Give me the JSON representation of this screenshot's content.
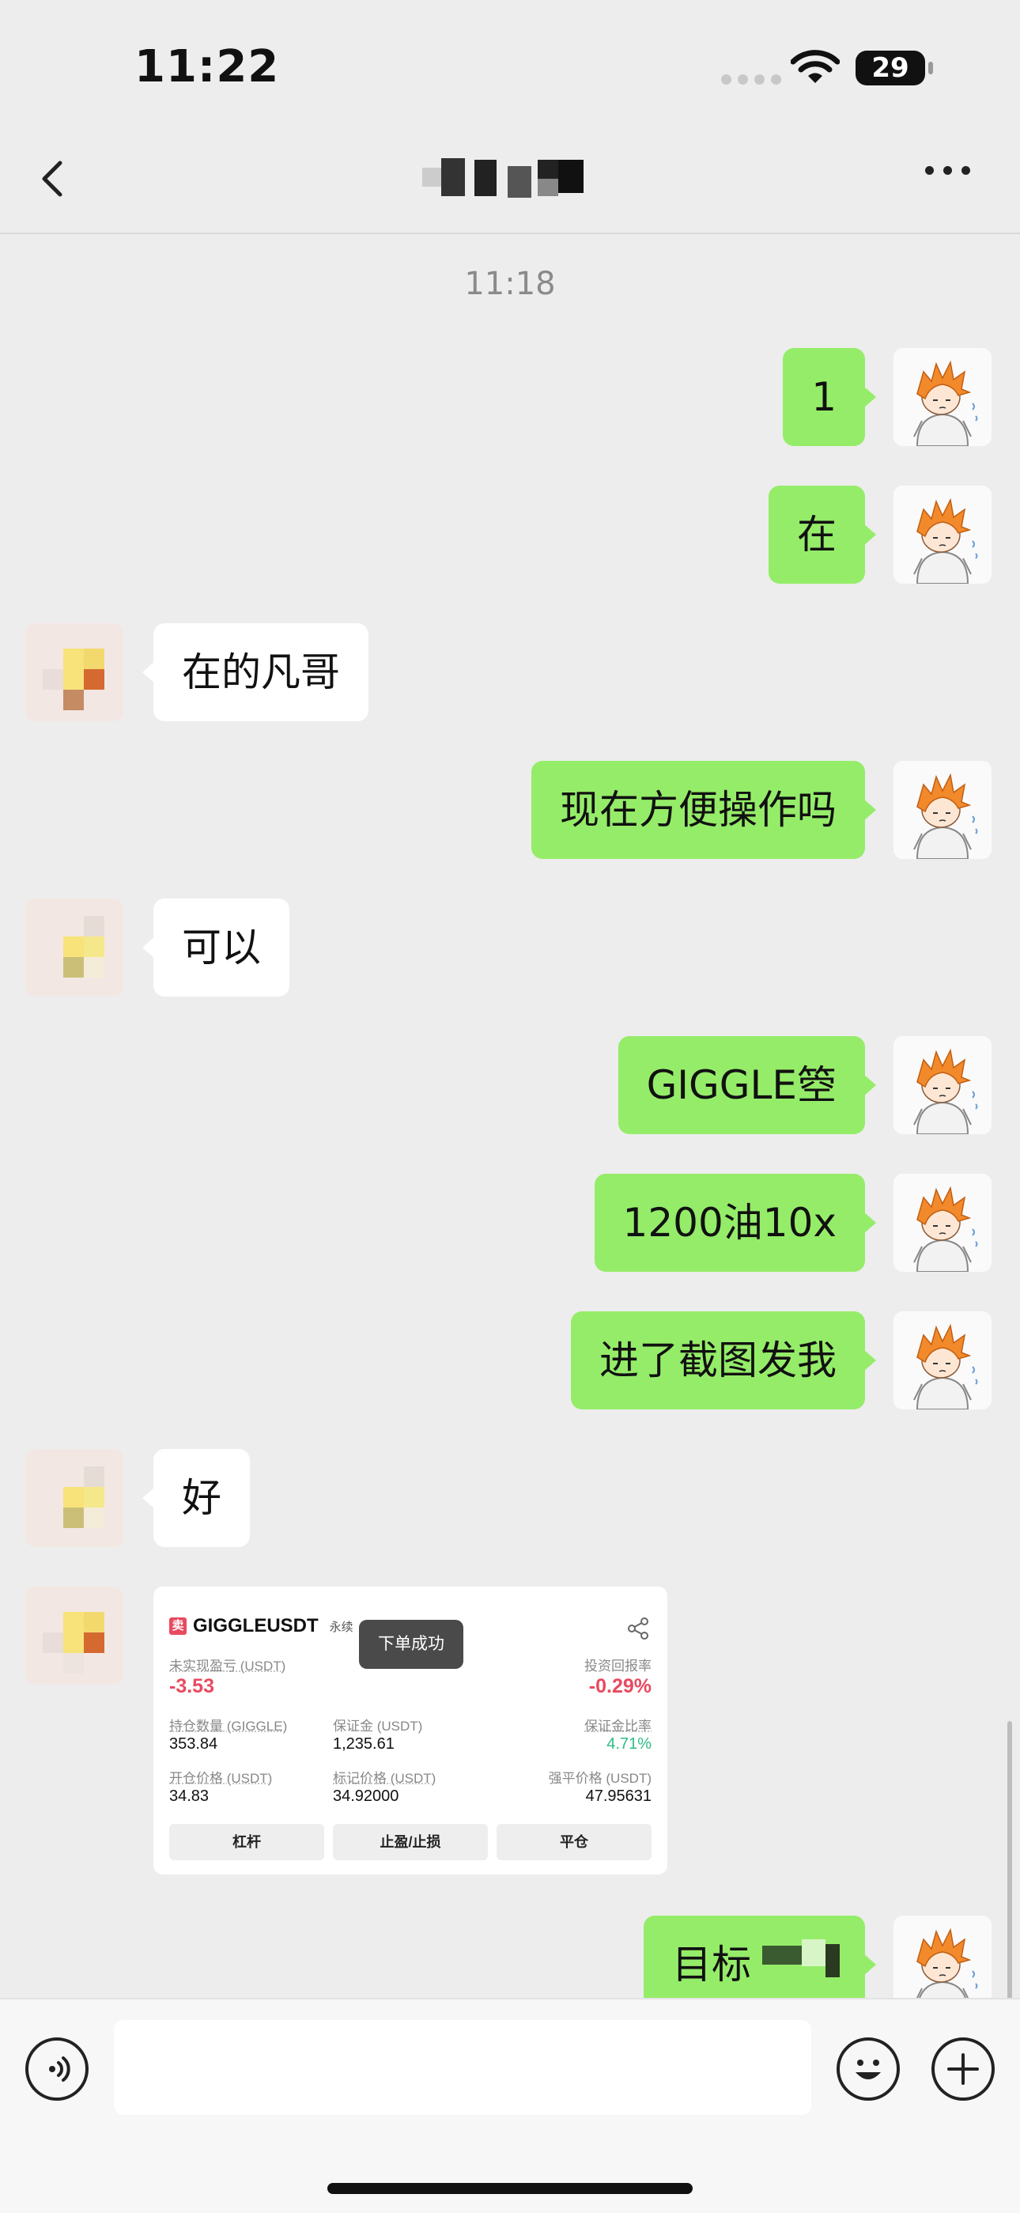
{
  "status_bar": {
    "time": "11:22",
    "battery": "29"
  },
  "header": {
    "back_label": "<",
    "more_label": "..."
  },
  "chat": {
    "timestamp": "11:18",
    "messages": [
      {
        "side": "me",
        "text": "1"
      },
      {
        "side": "me",
        "text": "在"
      },
      {
        "side": "them",
        "text": "在的凡哥"
      },
      {
        "side": "me",
        "text": "现在方便操作吗"
      },
      {
        "side": "them",
        "text": "可以"
      },
      {
        "side": "me",
        "text": "GIGGLE箜"
      },
      {
        "side": "me",
        "text": "1200油10x"
      },
      {
        "side": "me",
        "text": "进了截图发我"
      },
      {
        "side": "them",
        "text": "好"
      },
      {
        "side": "me",
        "text": "目标"
      }
    ],
    "trade_card": {
      "side_tag": "卖",
      "symbol": "GIGGLEUSDT",
      "contract_type": "永续",
      "toast": "下单成功",
      "unrealized_pnl_label": "未实现盈亏 (USDT)",
      "unrealized_pnl": "-3.53",
      "roi_label": "投资回报率",
      "roi": "-0.29%",
      "position_size_label": "持仓数量 (GIGGLE)",
      "position_size": "353.84",
      "margin_label": "保证金 (USDT)",
      "margin": "1,235.61",
      "margin_ratio_label": "保证金比率",
      "margin_ratio": "4.71%",
      "entry_price_label": "开仓价格 (USDT)",
      "entry_price": "34.83",
      "mark_price_label": "标记价格 (USDT)",
      "mark_price": "34.92000",
      "liq_price_label": "强平价格 (USDT)",
      "liq_price": "47.95631",
      "buttons": [
        "杠杆",
        "止盈/止损",
        "平仓"
      ]
    }
  },
  "colors": {
    "my_bubble": "#95ec69",
    "their_bubble": "#ffffff",
    "loss": "#e84a5f",
    "gain": "#2ebd85"
  }
}
